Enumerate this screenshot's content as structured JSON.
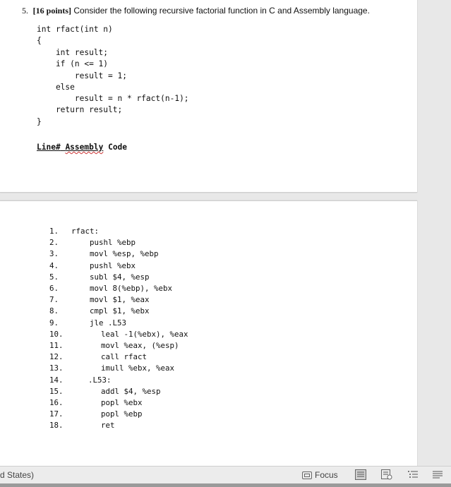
{
  "question": {
    "number": "5.",
    "points": "[16 points]",
    "text": "Consider the following recursive factorial function in C and Assembly language."
  },
  "c_code": [
    "int rfact(int n)",
    "{",
    "    int result;",
    "    if (n <= 1)",
    "        result = 1;",
    "    else",
    "        result = n * rfact(n-1);",
    "    return result;",
    "}"
  ],
  "table_heading": {
    "line": "Line#",
    "assembly": "Assembly",
    "code": "Code"
  },
  "assembly": [
    {
      "num": "1.",
      "code": "rfact:"
    },
    {
      "num": "2.",
      "code": "pushl %ebp"
    },
    {
      "num": "3.",
      "code": "movl %esp, %ebp"
    },
    {
      "num": "4.",
      "code": "pushl %ebx"
    },
    {
      "num": "5.",
      "code": "subl $4, %esp"
    },
    {
      "num": "6.",
      "code": "movl 8(%ebp), %ebx"
    },
    {
      "num": "7.",
      "code": "movl $1, %eax"
    },
    {
      "num": "8.",
      "code": "cmpl $1, %ebx"
    },
    {
      "num": "9.",
      "code": "jle .L53"
    },
    {
      "num": "10.",
      "code": "leal -1(%ebx), %eax"
    },
    {
      "num": "11.",
      "code": "movl %eax, (%esp)"
    },
    {
      "num": "12.",
      "code": "call rfact"
    },
    {
      "num": "13.",
      "code": "imull %ebx, %eax"
    },
    {
      "num": "14.",
      "code": ".L53:"
    },
    {
      "num": "15.",
      "code": "addl $4, %esp"
    },
    {
      "num": "16.",
      "code": "popl %ebx"
    },
    {
      "num": "17.",
      "code": "popl %ebp"
    },
    {
      "num": "18.",
      "code": "ret"
    }
  ],
  "statusbar": {
    "language": "d States)",
    "focus_label": "Focus"
  }
}
